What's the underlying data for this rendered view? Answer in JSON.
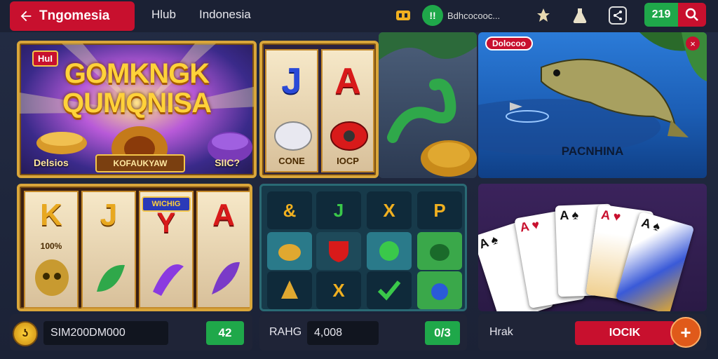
{
  "header": {
    "back_label": "Tngomesia",
    "nav": [
      "Hlub",
      "Indonesia"
    ],
    "account_text": "Bdhcocooc...",
    "account_badge": "!!",
    "icons": [
      "wallet-icon",
      "trophy-icon",
      "flask-icon",
      "share-icon"
    ],
    "balance": "219"
  },
  "tiles": {
    "slot1": {
      "badge": "HuI",
      "title_line1": "GOMKNGK",
      "title_line2": "QUMQNISA",
      "label_left": "Delsios",
      "label_right": "SIIC?",
      "banner": "KOFAUKYAW"
    },
    "slot2": {
      "symbols": [
        "J",
        "A"
      ],
      "labels": [
        "CONE",
        "IOCP"
      ]
    },
    "fish": {
      "tag": "Dolocoo",
      "name": "PACNHINA",
      "close": "×"
    },
    "slot3": {
      "symbols": [
        "K",
        "J",
        "Y",
        "A"
      ],
      "banner": "WICHIG",
      "note": "100%"
    },
    "slot4": {
      "symbols": [
        "&",
        "J",
        "X",
        "P",
        "X"
      ]
    },
    "cards": {
      "ranks": [
        "A",
        "A",
        "A",
        "A",
        "A"
      ]
    }
  },
  "bottom": {
    "bar1": {
      "coin": "ʖ",
      "field": "SIM200DM000",
      "button": "42"
    },
    "bar2": {
      "label": "RAHG",
      "field": "4,008",
      "button": "0/3"
    },
    "bar3": {
      "label": "Hrak",
      "button": "IOCIK",
      "plus": "+"
    }
  },
  "colors": {
    "accent_red": "#c8102e",
    "accent_green": "#1fa84a",
    "gold": "#d9a63a",
    "bg": "#1b2236"
  }
}
